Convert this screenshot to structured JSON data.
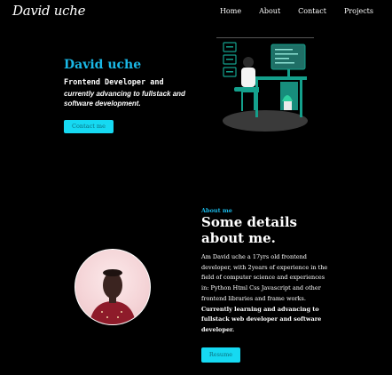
{
  "nav": {
    "logo": "David uche",
    "links": [
      "Home",
      "About",
      "Contact",
      "Projects"
    ]
  },
  "hero": {
    "name": "David uche",
    "role": "Frontend Developer and",
    "tagline": "currently advancing to fullstack and software development.",
    "cta_label": "Contact me",
    "illustration": "developer-at-desk-illustration"
  },
  "about": {
    "kicker": "About me",
    "title": "Some details about me.",
    "body": "Am David uche a 17yrs old frontend developer, with 2years of experience in the field of computer science and experiences in: Python Html Css Javascript and other frontend libraries and frame works.",
    "body_bold": "Currently learning and advancing to fullstack web developer and software developer.",
    "resume_label": "Resume",
    "photo": "profile-photo"
  },
  "colors": {
    "background": "#000000",
    "accent": "#1ab8e6",
    "button": "#16d9f2",
    "button_text": "#0a6f7f",
    "illustration_green": "#14a08c"
  }
}
